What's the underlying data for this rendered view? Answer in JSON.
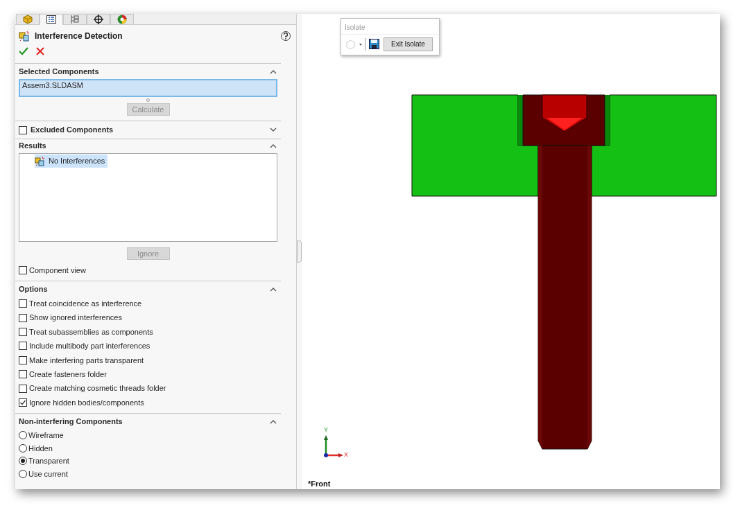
{
  "tabs": [
    {
      "selected": false
    },
    {
      "selected": true
    },
    {
      "selected": false
    },
    {
      "selected": false
    },
    {
      "selected": false
    }
  ],
  "feature": {
    "title": "Interference Detection"
  },
  "selected_components": {
    "title": "Selected Components",
    "value": "Assem3.SLDASM",
    "button": "Calculate"
  },
  "excluded_components": {
    "label": "Excluded Components",
    "checked": false
  },
  "results": {
    "title": "Results",
    "items": [
      {
        "label": "No Interferences",
        "selected": true
      }
    ],
    "button": "Ignore"
  },
  "component_view": {
    "label": "Component view",
    "checked": false
  },
  "options": {
    "title": "Options",
    "items": [
      {
        "label": "Treat coincidence as interference",
        "checked": false
      },
      {
        "label": "Show ignored interferences",
        "checked": false
      },
      {
        "label": "Treat subassemblies as components",
        "checked": false
      },
      {
        "label": "Include multibody part interferences",
        "checked": false
      },
      {
        "label": "Make interfering parts transparent",
        "checked": false
      },
      {
        "label": "Create fasteners folder",
        "checked": false
      },
      {
        "label": "Create matching cosmetic threads folder",
        "checked": false
      },
      {
        "label": "Ignore hidden bodies/components",
        "checked": true
      }
    ]
  },
  "non_interfering": {
    "title": "Non-interfering Components",
    "items": [
      {
        "label": "Wireframe",
        "selected": false
      },
      {
        "label": "Hidden",
        "selected": false
      },
      {
        "label": "Transparent",
        "selected": true
      },
      {
        "label": "Use current",
        "selected": false
      }
    ]
  },
  "isolate_popup": {
    "title": "Isolate",
    "button": "Exit Isolate"
  },
  "axes": {
    "x": "X",
    "y": "Y"
  },
  "view_label": "*Front"
}
